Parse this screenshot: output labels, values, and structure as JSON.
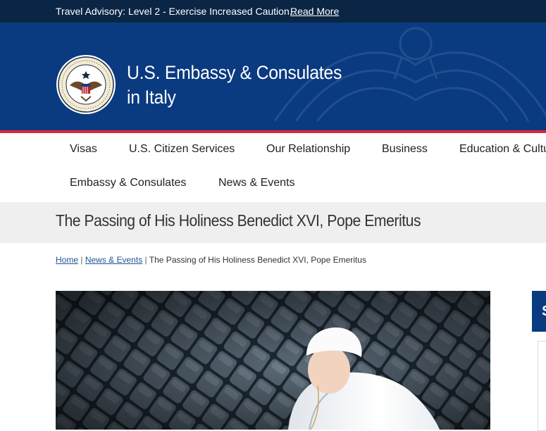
{
  "advisory": {
    "text": "Travel Advisory: Level 2 - Exercise Increased Caution...",
    "link": "Read More"
  },
  "header": {
    "title_line1": "U.S. Embassy & Consulates",
    "title_line2": "in Italy",
    "seal_text": "DEPARTMENT OF STATE · UNITED STATES OF AMERICA"
  },
  "nav": {
    "items": [
      {
        "label": "Visas"
      },
      {
        "label": "U.S. Citizen Services"
      },
      {
        "label": "Our Relationship"
      },
      {
        "label": "Business"
      },
      {
        "label": "Education & Cultu"
      },
      {
        "label": "Embassy & Consulates"
      },
      {
        "label": "News & Events"
      }
    ]
  },
  "page": {
    "title": "The Passing of His Holiness Benedict XVI, Pope Emeritus"
  },
  "breadcrumb": {
    "home": "Home",
    "sep1": "|",
    "news": "News & Events",
    "sep2": "|",
    "current": "The Passing of His Holiness Benedict XVI, Pope Emeritus"
  },
  "sidebar": {
    "card_letter": "S"
  },
  "colors": {
    "advisory_bg": "#0b2545",
    "header_bg": "#0a3a80",
    "accent_red": "#d7283b",
    "title_band_bg": "#efefef",
    "link": "#205493"
  }
}
